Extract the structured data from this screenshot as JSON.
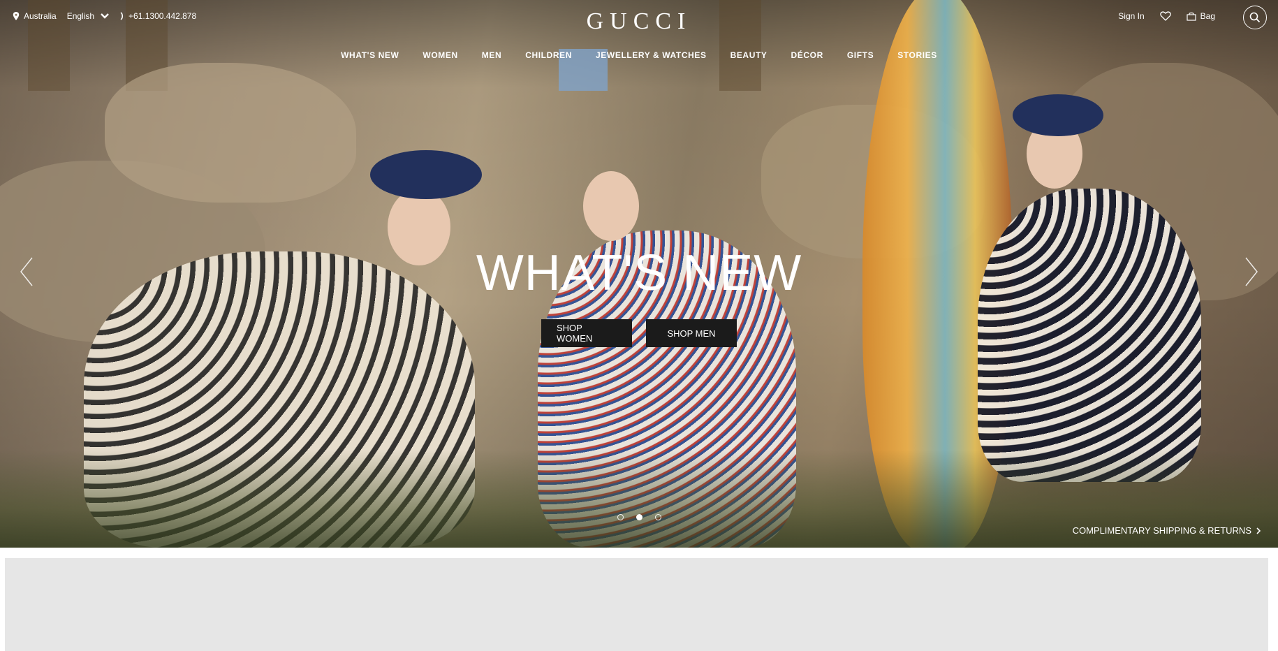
{
  "topbar": {
    "country": "Australia",
    "language": "English",
    "phone": "+61.1300.442.878",
    "sign_in": "Sign In",
    "bag": "Bag"
  },
  "brand": {
    "logo_text": "GUCCI"
  },
  "nav": {
    "items": [
      "WHAT'S NEW",
      "WOMEN",
      "MEN",
      "CHILDREN",
      "JEWELLERY & WATCHES",
      "BEAUTY",
      "DÉCOR",
      "GIFTS",
      "STORIES"
    ]
  },
  "hero": {
    "headline": "WHAT'S NEW",
    "cta_women": "SHOP WOMEN",
    "cta_men": "SHOP MEN",
    "slides_total": 3,
    "active_slide": 2,
    "shipping_link": "COMPLIMENTARY SHIPPING & RETURNS"
  },
  "icons": {
    "location": "pin-icon",
    "language_dropdown": "chevron-down-icon",
    "phone": "phone-icon",
    "wishlist": "heart-icon",
    "bag": "bag-icon",
    "search": "search-icon",
    "prev": "arrow-left-icon",
    "next": "arrow-right-icon"
  },
  "colors": {
    "text_on_hero": "#ffffff",
    "cta_background": "#1b1b1b",
    "panel_background": "#e6e6e6"
  }
}
